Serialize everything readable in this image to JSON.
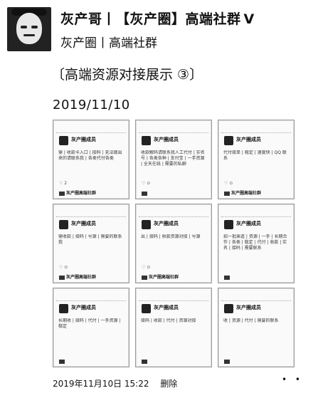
{
  "header": {
    "title": "灰产哥丨【灰产圈】高端社群",
    "verified_mark": "V",
    "subtitle": "灰产圈丨高端社群"
  },
  "post": {
    "heading": "〔高端资源对接展示 ③〕",
    "date": "2019/11/10",
    "footer_time": "2019年11月10日 15:22",
    "delete_label": "删除",
    "more_label": "• •"
  },
  "screenshots": [
    {
      "name": "灰产圈成员",
      "body": "需 | 收款卡入口 | 接码 | 无法做出来的请联系我 | 各类代付各类",
      "stats": "♡ 2",
      "group": "灰产圈高端社群"
    },
    {
      "name": "灰产圈成员",
      "body": "收款解码请联系我人工代付 | 实名号 | 各类各种 | 支付宝 | 一手资源 | 全天在线 | 需要的私聊",
      "stats": "♡ ⊙",
      "group": ""
    },
    {
      "name": "灰产圈成员",
      "body": "代付接单 | 稳定 | 速度快 | QQ 联系",
      "stats": "♡ ⊙",
      "group": "灰产圈高端社群"
    },
    {
      "name": "灰产圈成员",
      "body": "需收款 | 接码 | 号源 | 需要的联系我",
      "stats": "♡ ⊙",
      "group": "灰产圈高端社群"
    },
    {
      "name": "灰产圈成员",
      "body": "出 | 接码 | 收款资源对接 | 号源",
      "stats": "♡ ⊙",
      "group": "灰产圈高端社群"
    },
    {
      "name": "灰产圈成员",
      "body": "招一批渠道 | 资源 | 一手 | 长期合作 | 各类 | 稳定 | 代付 | 收款 | 实名 | 接码 | 需要联系",
      "stats": "",
      "group": ""
    },
    {
      "name": "灰产圈成员",
      "body": "长期收 | 接码 | 代付 | 一手资源 | 稳定",
      "stats": "",
      "group": ""
    },
    {
      "name": "灰产圈成员",
      "body": "接码 | 收款 | 代付 | 资源对接",
      "stats": "",
      "group": ""
    },
    {
      "name": "灰产圈成员",
      "body": "收 | 资源 | 代付 | 需要的联系",
      "stats": "",
      "group": ""
    }
  ]
}
